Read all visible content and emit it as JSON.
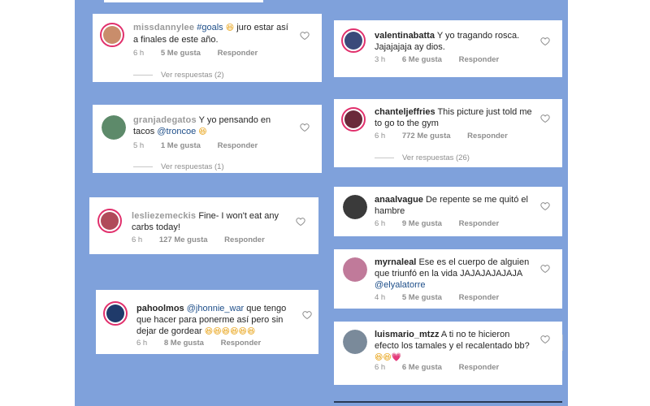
{
  "comments": [
    {
      "user": "missdannylee",
      "text_before": "",
      "hashtag": "#goals",
      "emoji": "😆",
      "text_after": " juro estar así a finales de este año.",
      "time": "6 h",
      "likes": "5 Me gusta",
      "reply": "Responder",
      "view_replies": "Ver respuestas (2)",
      "avatar_color": "#c98d6b"
    },
    {
      "user": "valentinabatta",
      "text": "Y yo tragando rosca. Jajajajaja ay dios.",
      "time": "3 h",
      "likes": "6 Me gusta",
      "reply": "Responder",
      "avatar_color": "#3b4a7a"
    },
    {
      "user": "granjadegatos",
      "text": "Y yo pensando en tacos",
      "mention": "@troncoe",
      "emoji": "😆",
      "time": "5 h",
      "likes": "1 Me gusta",
      "reply": "Responder",
      "view_replies": "Ver respuestas (1)",
      "avatar_color": "#5d8a6a"
    },
    {
      "user": "chanteljeffries",
      "text": "This picture just told me to go to the gym",
      "time": "6 h",
      "likes": "772 Me gusta",
      "reply": "Responder",
      "view_replies": "Ver respuestas (26)",
      "avatar_color": "#6a2a3a"
    },
    {
      "user": "lesliezemeckis",
      "text": "Fine- I won't eat any carbs today!",
      "time": "6 h",
      "likes": "127 Me gusta",
      "reply": "Responder",
      "avatar_color": "#b04a5a"
    },
    {
      "user": "anaalvague",
      "text": "De repente se me quitó el hambre",
      "time": "6 h",
      "likes": "9 Me gusta",
      "reply": "Responder",
      "avatar_color": "#3a3a3a"
    },
    {
      "user": "myrnaleal",
      "text": "Ese es el cuerpo de alguien que triunfó en la vida JAJAJAJAJAJA",
      "mention": "@elyalatorre",
      "time": "4 h",
      "likes": "5 Me gusta",
      "reply": "Responder",
      "avatar_color": "#c07a9a"
    },
    {
      "user": "pahoolmos",
      "mention": "@jhonnie_war",
      "text": " que tengo que hacer para ponerme así pero sin dejar de gordear",
      "emoji": "😆😆😆😆😆😆",
      "time": "6 h",
      "likes": "8 Me gusta",
      "reply": "Responder",
      "avatar_color": "#1f3a6a"
    },
    {
      "user": "luismario_mtzz",
      "text": "A ti no te hicieron efecto los tamales y el recalentado bb?",
      "emoji": "😆😆",
      "heart": "💗",
      "time": "6 h",
      "likes": "6 Me gusta",
      "reply": "Responder",
      "avatar_color": "#7a8a9a"
    }
  ],
  "icons": {
    "like": "heart-outline-icon"
  },
  "colors": {
    "panel": "#7fa1db",
    "ring": "#e1306c",
    "link": "#1d4e89"
  }
}
